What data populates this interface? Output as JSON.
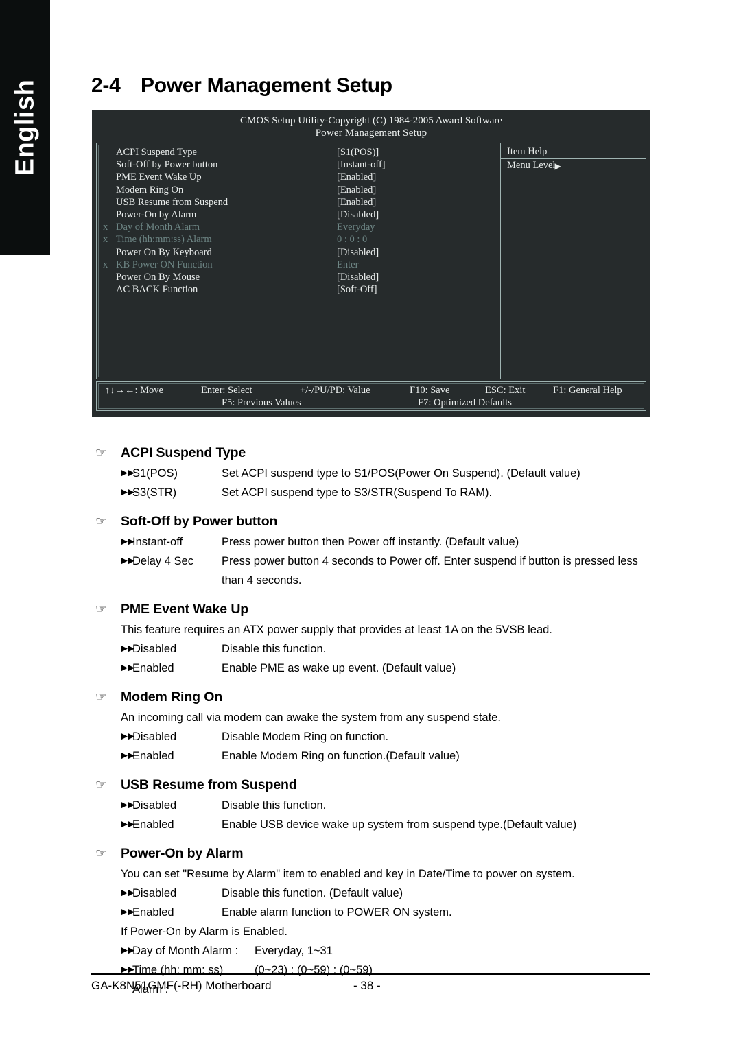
{
  "sidebar": {
    "language_tab": "English"
  },
  "heading": {
    "section_number": "2-4",
    "title": "Power Management Setup"
  },
  "bios": {
    "title_line1": "CMOS Setup Utility-Copyright (C) 1984-2005 Award Software",
    "title_line2": "Power Management Setup",
    "help": {
      "header": "Item Help",
      "menu_level": "Menu Level",
      "menu_level_arrow": "▶"
    },
    "items": [
      {
        "x": "",
        "label": "ACPI Suspend Type",
        "value": "[S1(POS)]",
        "dim": false
      },
      {
        "x": "",
        "label": "Soft-Off by Power button",
        "value": "[Instant-off]",
        "dim": false
      },
      {
        "x": "",
        "label": "PME Event Wake Up",
        "value": "[Enabled]",
        "dim": false
      },
      {
        "x": "",
        "label": "Modem Ring On",
        "value": "[Enabled]",
        "dim": false
      },
      {
        "x": "",
        "label": "USB Resume from Suspend",
        "value": "[Enabled]",
        "dim": false
      },
      {
        "x": "",
        "label": "Power-On by Alarm",
        "value": "[Disabled]",
        "dim": false
      },
      {
        "x": "x",
        "label": "Day of Month Alarm",
        "value": "Everyday",
        "dim": true
      },
      {
        "x": "x",
        "label": "Time (hh:mm:ss) Alarm",
        "value": "0 : 0 : 0",
        "dim": true
      },
      {
        "x": "",
        "label": "Power On By Keyboard",
        "value": "[Disabled]",
        "dim": false
      },
      {
        "x": "x",
        "label": "KB Power ON Function",
        "value": "Enter",
        "dim": true
      },
      {
        "x": "",
        "label": "Power On By Mouse",
        "value": "[Disabled]",
        "dim": false
      },
      {
        "x": "",
        "label": "AC BACK Function",
        "value": "[Soft-Off]",
        "dim": false
      }
    ],
    "keys": {
      "move": "↑↓→←: Move",
      "select": "Enter: Select",
      "value": "+/-/PU/PD: Value",
      "save": "F10: Save",
      "exit": "ESC: Exit",
      "general_help": "F1: General Help",
      "previous_values": "F5: Previous Values",
      "optimized_defaults": "F7: Optimized Defaults"
    }
  },
  "glyphs": {
    "hand": "☞",
    "marker": "▶▶"
  },
  "sections": [
    {
      "title": "ACPI Suspend Type",
      "options": [
        {
          "name": "S1(POS)",
          "desc": "Set ACPI suspend type to S1/POS(Power On Suspend). (Default value)"
        },
        {
          "name": "S3(STR)",
          "desc": "Set ACPI suspend type to S3/STR(Suspend To RAM)."
        }
      ]
    },
    {
      "title": "Soft-Off by Power button",
      "options": [
        {
          "name": "Instant-off",
          "desc": "Press power button then Power off instantly. (Default value)"
        },
        {
          "name": "Delay 4 Sec",
          "desc": "Press power button 4 seconds to Power off. Enter suspend if button is pressed less",
          "cont": "than 4 seconds."
        }
      ]
    },
    {
      "title": "PME Event Wake Up",
      "note": "This feature requires an ATX power supply that provides at least 1A on the 5VSB lead.",
      "options": [
        {
          "name": "Disabled",
          "desc": "Disable this function."
        },
        {
          "name": "Enabled",
          "desc": "Enable PME as wake up event. (Default value)"
        }
      ]
    },
    {
      "title": "Modem Ring On",
      "note": "An incoming call via modem can awake the system from any suspend state.",
      "options": [
        {
          "name": "Disabled",
          "desc": "Disable Modem Ring on function."
        },
        {
          "name": "Enabled",
          "desc": "Enable Modem Ring on function.(Default value)"
        }
      ]
    },
    {
      "title": "USB Resume from Suspend",
      "options": [
        {
          "name": "Disabled",
          "desc": "Disable this function."
        },
        {
          "name": "Enabled",
          "desc": "Enable USB device wake up system from suspend type.(Default value)"
        }
      ]
    },
    {
      "title": "Power-On by Alarm",
      "note": "You can set \"Resume by Alarm\" item to enabled and key in Date/Time to power on system.",
      "options": [
        {
          "name": "Disabled",
          "desc": "Disable this function. (Default value)"
        },
        {
          "name": "Enabled",
          "desc": "Enable alarm function to POWER ON system."
        }
      ],
      "note2": "If Power-On by Alarm is Enabled.",
      "options2": [
        {
          "name": "Day of Month Alarm :",
          "desc": "Everyday, 1~31"
        },
        {
          "name": "Time (hh: mm: ss) Alarm :",
          "desc": "(0~23) : (0~59) : (0~59)"
        }
      ]
    }
  ],
  "footer": {
    "motherboard": "GA-K8N51GMF(-RH) Motherboard",
    "page_number": "- 38 -"
  }
}
